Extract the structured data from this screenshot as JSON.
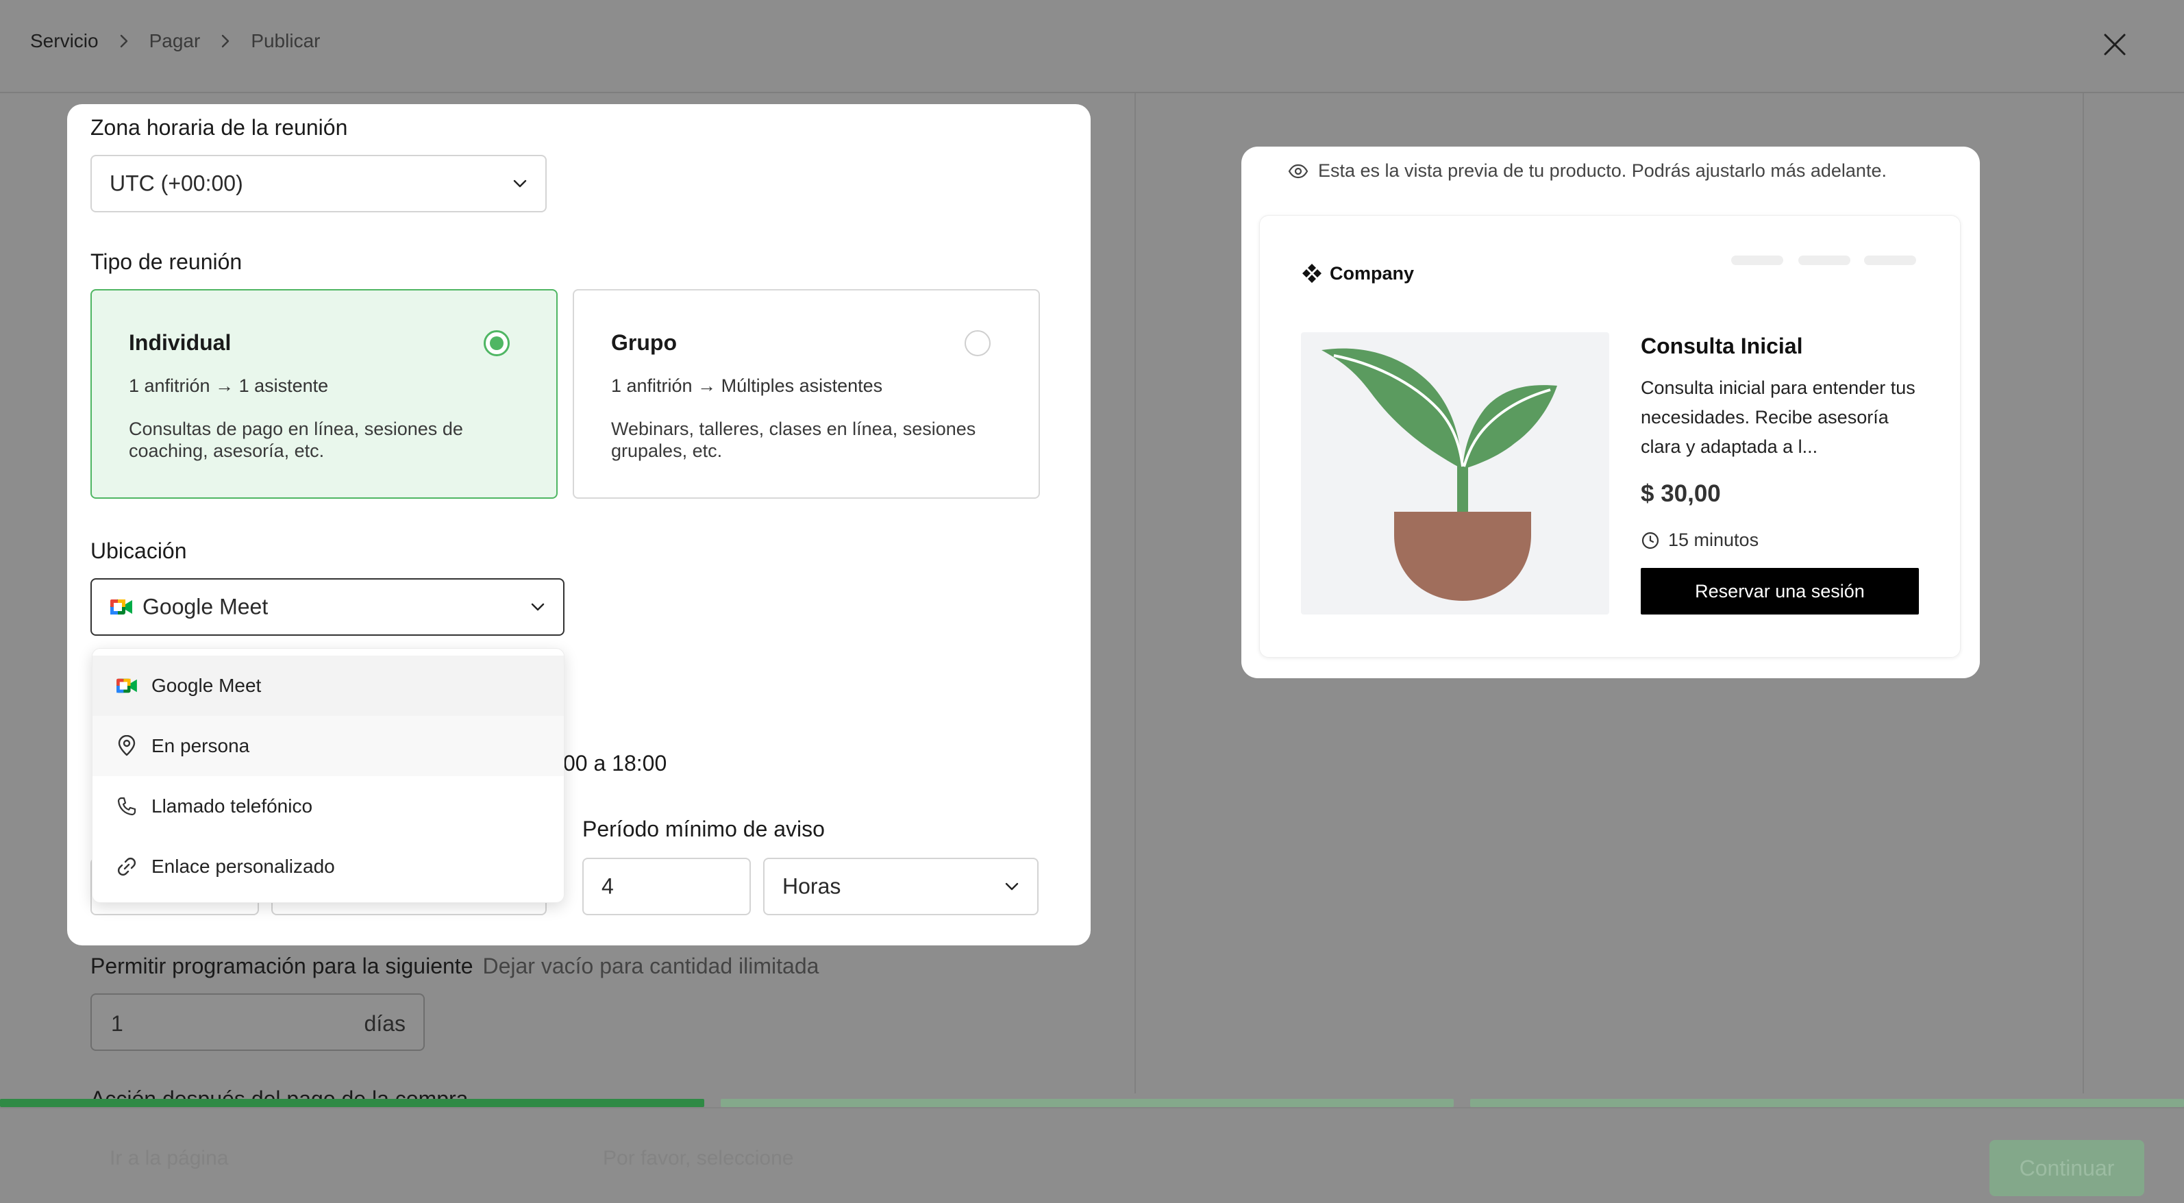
{
  "breadcrumb": {
    "step1": "Servicio",
    "step2": "Pagar",
    "step3": "Publicar"
  },
  "background": {
    "allow_label": "Permitir programación para la siguiente",
    "allow_hint": "Dejar vacío para cantidad ilimitada",
    "days_value": "1",
    "days_unit": "días",
    "accion_label": "Acción después del pago de la compra",
    "continue_label": "Continuar",
    "progress_fraction": 0.33
  },
  "form": {
    "timezone_label": "Zona horaria de la reunión",
    "timezone_value": "UTC (+00:00)",
    "meeting_type_label": "Tipo de reunión",
    "meeting_types": [
      {
        "title": "Individual",
        "ratio": "1 anfitrión → 1 asistente",
        "desc": "Consultas de pago en línea, sesiones de coaching, asesoría, etc.",
        "selected": true
      },
      {
        "title": "Grupo",
        "ratio": "1 anfitrión → Múltiples asistentes",
        "desc": "Webinars, talleres, clases en línea, sesiones grupales, etc.",
        "selected": false
      }
    ],
    "location_label": "Ubicación",
    "location_value": "Google Meet",
    "schedule_partial": "00 a 18:00",
    "notice_label": "Período mínimo de aviso",
    "notice_value": "4",
    "notice_unit": "Horas"
  },
  "dropdown": {
    "options": [
      {
        "label": "Google Meet",
        "icon": "google-meet-icon"
      },
      {
        "label": "En persona",
        "icon": "map-pin-icon"
      },
      {
        "label": "Llamado telefónico",
        "icon": "phone-icon"
      },
      {
        "label": "Enlace personalizado",
        "icon": "link-icon"
      }
    ],
    "highlighted_index": 0,
    "hovered_index": 1
  },
  "preview": {
    "note": "Esta es la vista previa de tu producto. Podrás ajustarlo más adelante.",
    "brand": "Company",
    "title": "Consulta Inicial",
    "desc": "Consulta inicial para entender tus necesidades. Recibe asesoría clara y adaptada a l...",
    "price": "$ 30,00",
    "duration": "15 minutos",
    "book_label": "Reservar una sesión"
  },
  "colors": {
    "accent_green": "#4fb663",
    "selected_bg": "#e9f7ec",
    "overlay": "#8d8d8d",
    "book_button": "#000000"
  }
}
